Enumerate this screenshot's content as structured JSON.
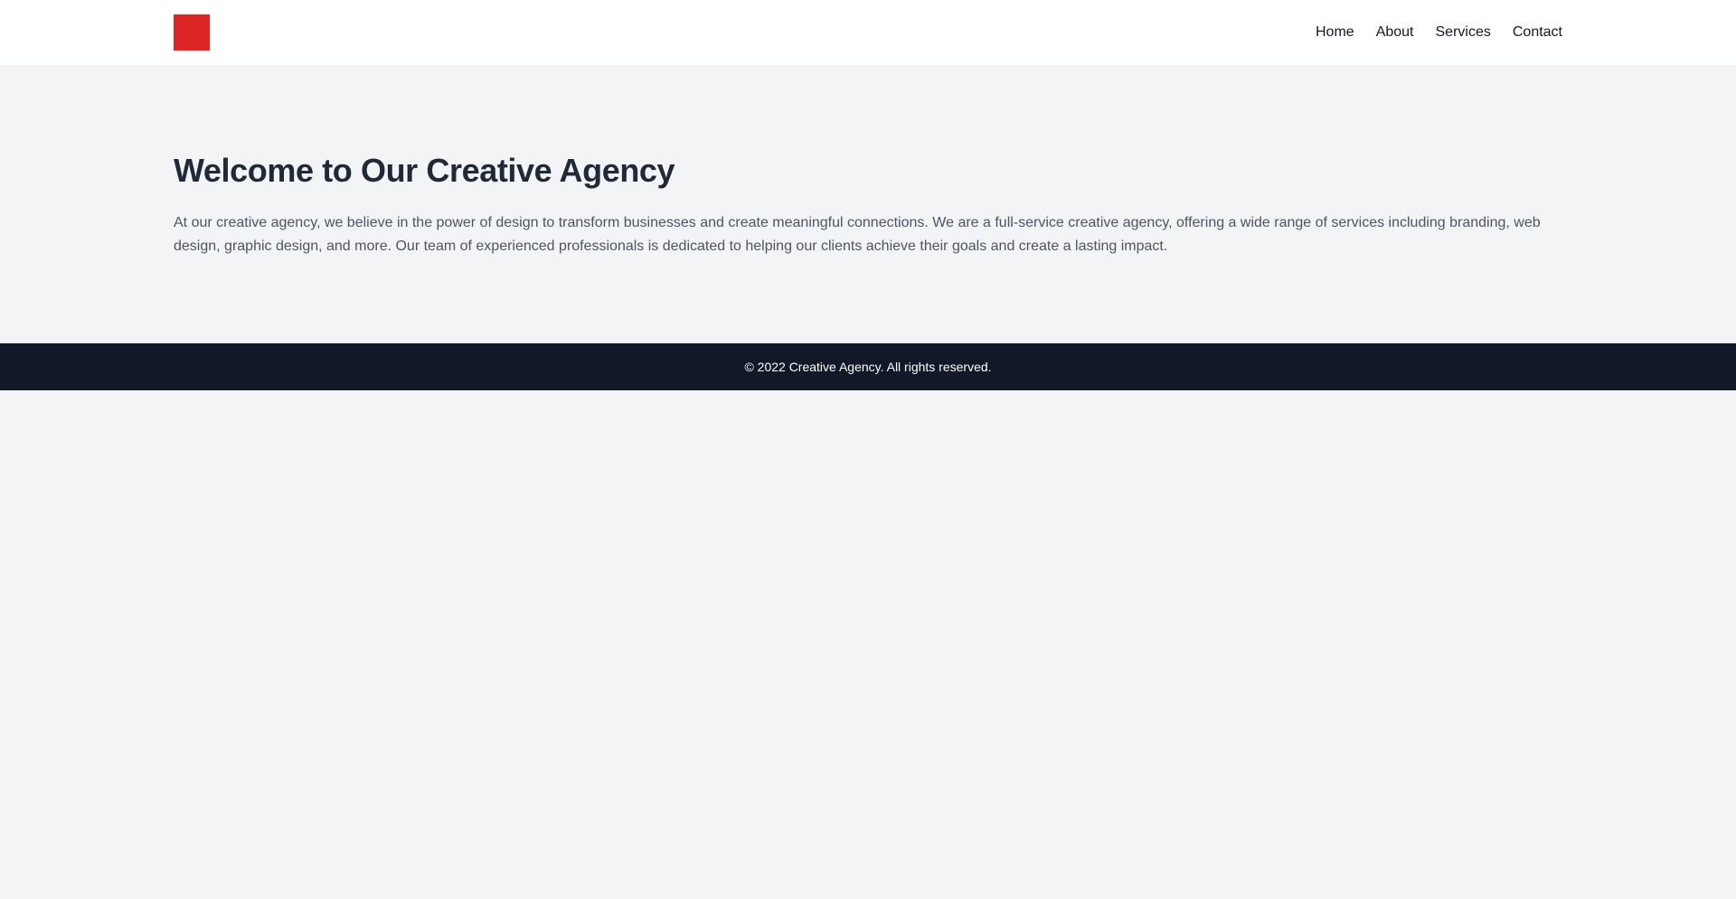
{
  "header": {
    "logo_color": "#dc2626",
    "nav": [
      "Home",
      "About",
      "Services",
      "Contact"
    ]
  },
  "hero": {
    "title": "Welcome to Our Creative Agency",
    "body": "At our creative agency, we believe in the power of design to transform businesses and create meaningful connections. We are a full-service creative agency, offering a wide range of services including branding, web design, graphic design, and more. Our team of experienced professionals is dedicated to helping our clients achieve their goals and create a lasting impact."
  },
  "footer": {
    "text": "© 2022 Creative Agency. All rights reserved."
  },
  "colors": {
    "page_bg": "#f3f4f6",
    "header_bg": "#ffffff",
    "footer_bg": "#111827",
    "title": "#1f2937",
    "body_text": "#4b5563"
  }
}
